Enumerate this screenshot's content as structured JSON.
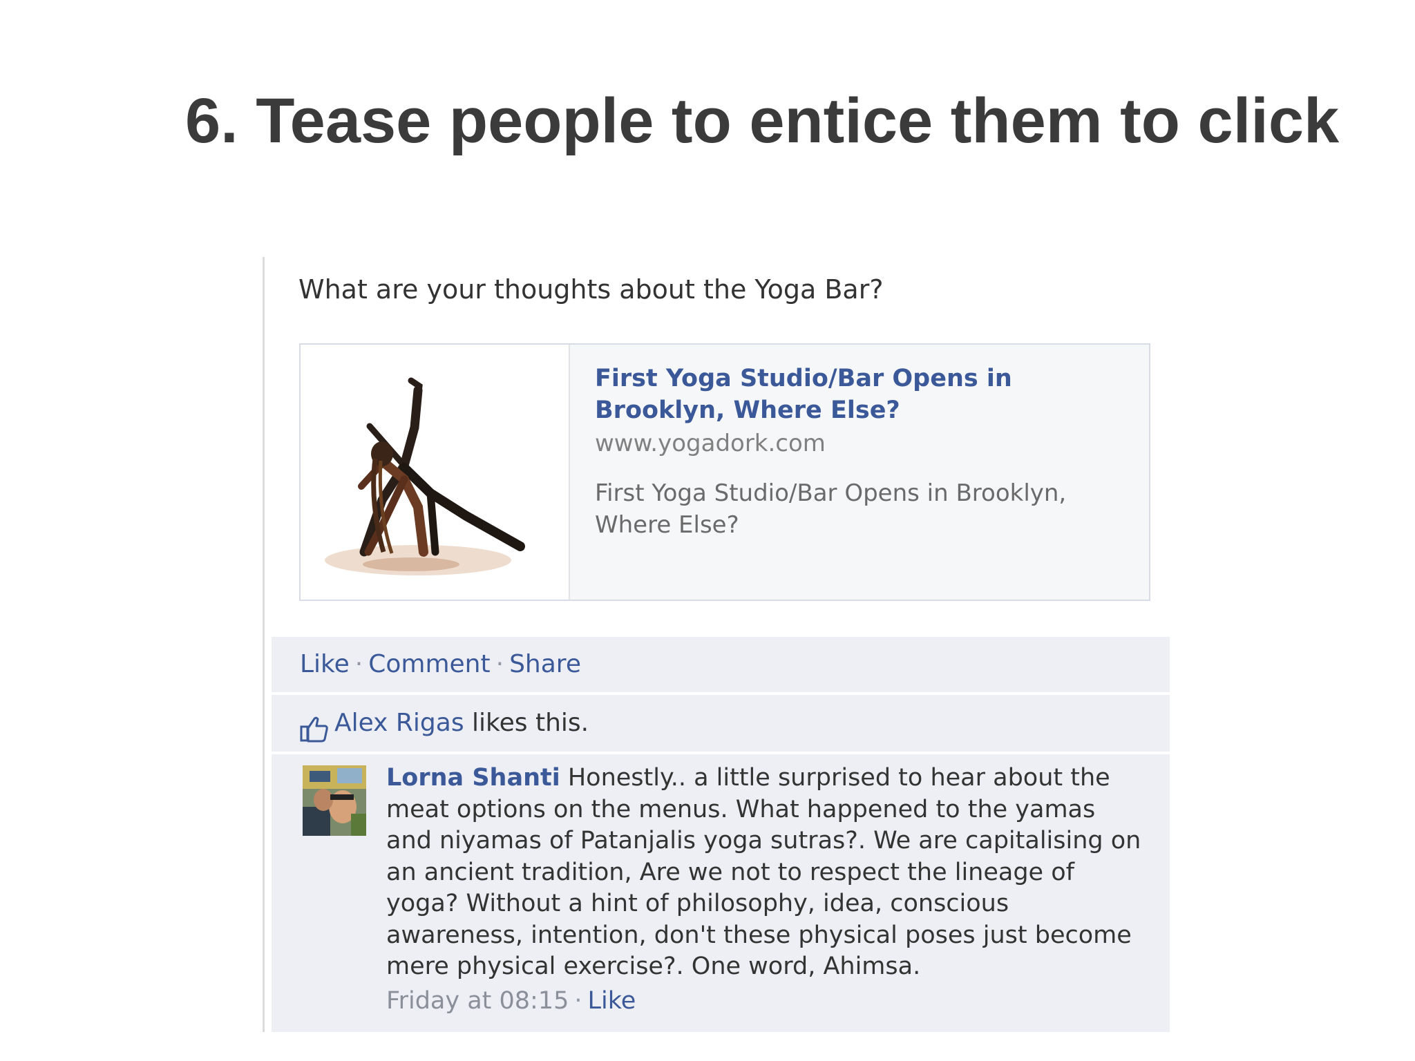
{
  "slide": {
    "title": "6. Tease people to entice them to click"
  },
  "post": {
    "message": "What are your thoughts about the Yoga Bar?",
    "attachment": {
      "title": "First Yoga Studio/Bar Opens in Brooklyn, Where Else?",
      "domain": "www.yogadork.com",
      "description": "First Yoga Studio/Bar Opens in Brooklyn, Where Else?"
    },
    "actions": {
      "like": "Like",
      "comment": "Comment",
      "share": "Share",
      "separator": "·"
    },
    "likes": {
      "user": "Alex Rigas",
      "suffix": "likes this."
    },
    "comment": {
      "author": "Lorna Shanti",
      "text": "Honestly.. a little surprised to hear about the meat options on the menus. What happened to the yamas and niyamas of Patanjalis yoga sutras?. We are capitalising on an ancient tradition, Are we not to respect the lineage of yoga? Without a hint of philosophy, idea, conscious awareness, intention, don't these physical poses just become mere physical exercise?. One word, Ahimsa.",
      "timestamp": "Friday at 08:15",
      "separator": "·",
      "like": "Like"
    }
  },
  "icons": {
    "like": "thumbs-up-icon"
  },
  "colors": {
    "link": "#3b5998",
    "title_text": "#3b3b3b",
    "bar_background": "#edeff4"
  }
}
